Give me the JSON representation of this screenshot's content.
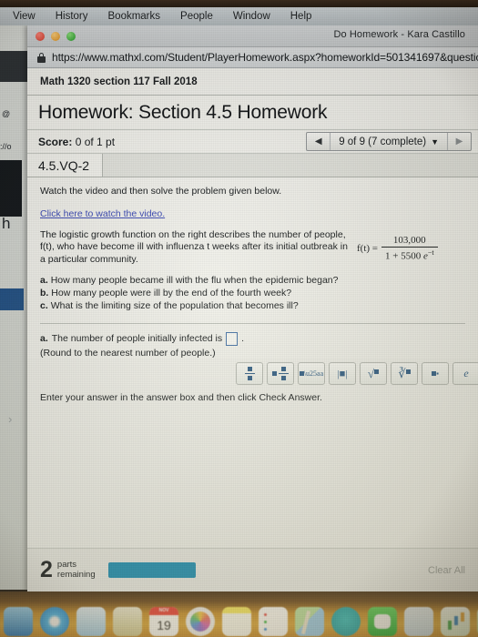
{
  "menubar": {
    "items": [
      "View",
      "History",
      "Bookmarks",
      "People",
      "Window",
      "Help"
    ]
  },
  "browser": {
    "window_title": "Do Homework - Kara Castillo",
    "lock_icon": "lock-icon",
    "url": "https://www.mathxl.com/Student/PlayerHomework.aspx?homeworkId=501341697&questio"
  },
  "background_window": {
    "fragment_1": "@",
    "fragment_2": "://o",
    "fragment_3": "h",
    "chevron": "›"
  },
  "page": {
    "course_title": "Math 1320 section 117 Fall 2018",
    "homework_title": "Homework: Section 4.5 Homework",
    "score_label": "Score:",
    "score_value": "0 of 1 pt",
    "nav": {
      "prev_icon": "◀",
      "next_icon": "▶",
      "position_label": "9 of 9 (7 complete)",
      "caret_icon": "▼"
    },
    "question_tab": "4.5.VQ-2",
    "instruction": "Watch the video and then solve the problem given below.",
    "video_link": "Click here to watch the video.",
    "problem_text": "The logistic growth function on the right describes the number of people, f(t), who have become ill with influenza t weeks after its initial outbreak in a particular community.",
    "formula": {
      "lhs": "f(t) =",
      "numerator": "103,000",
      "denominator_prefix": "1 + 5500",
      "denominator_base": "e",
      "denominator_exponent": "−t"
    },
    "parts": [
      {
        "letter": "a.",
        "text": "How many people became ill with the flu when the epidemic began?"
      },
      {
        "letter": "b.",
        "text": "How many people were ill by the end of the fourth week?"
      },
      {
        "letter": "c.",
        "text": "What is the limiting size of the population that becomes ill?"
      }
    ],
    "answer": {
      "letter": "a.",
      "prompt": "The number of people initially infected is",
      "value": "",
      "trailing_period": ".",
      "round_note": "(Round to the nearest number of people.)"
    },
    "palette": [
      {
        "name": "fraction-button",
        "label": "fraction"
      },
      {
        "name": "mixed-fraction-button",
        "label": "mixed-fraction"
      },
      {
        "name": "exponent-button",
        "label": "exponent"
      },
      {
        "name": "absolute-value-button",
        "label": "|■|"
      },
      {
        "name": "square-root-button",
        "label": "√"
      },
      {
        "name": "nth-root-button",
        "label": "∛"
      },
      {
        "name": "subscript-button",
        "label": "subscript"
      },
      {
        "name": "e-constant-button",
        "label": "e"
      }
    ],
    "hint_text": "Enter your answer in the answer box and then click Check Answer.",
    "footer": {
      "parts_count": "2",
      "parts_label_line1": "parts",
      "parts_label_line2": "remaining",
      "check_answer_label": "",
      "clear_all_label": "Clear All",
      "accent_color": "#1b90b8"
    }
  },
  "dock": {
    "calendar_month": "NOV",
    "calendar_day": "19",
    "icons": [
      "finder-icon",
      "safari-icon",
      "mail-icon",
      "pages-icon",
      "calendar-icon",
      "photos-icon",
      "notes-icon",
      "reminders-icon",
      "maps-icon",
      "facetime-icon",
      "messages-icon",
      "appstore-icon",
      "numbers-icon",
      "keynote-icon"
    ]
  }
}
